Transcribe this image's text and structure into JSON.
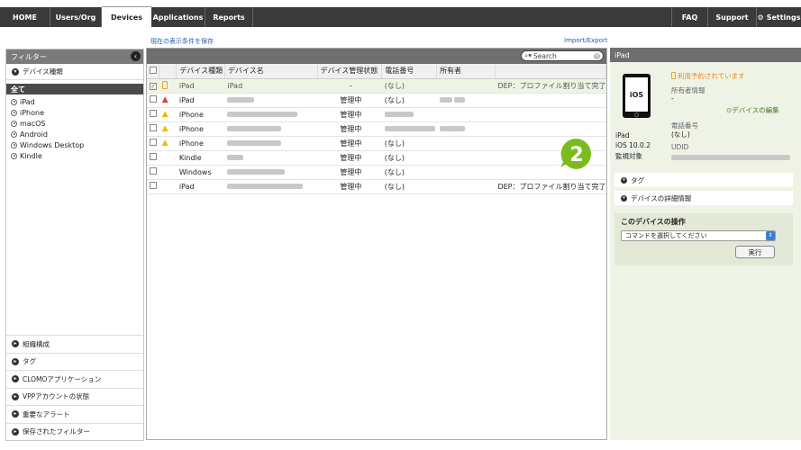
{
  "nav": {
    "tabs": [
      "HOME",
      "Users/Org",
      "Devices",
      "Applications",
      "Reports"
    ],
    "right": [
      "FAQ",
      "Support",
      "Settings"
    ],
    "active": "Devices"
  },
  "links": {
    "save_view": "現在の表示条件を保存",
    "import_export": "Import/Export"
  },
  "filter": {
    "title": "フィルター",
    "device_type_section": "デバイス種類",
    "items": [
      "全て",
      "iPad",
      "iPhone",
      "macOS",
      "Android",
      "Windows Desktop",
      "Kindle"
    ],
    "bottom_sections": [
      "組織構成",
      "タグ",
      "CLOMOアプリケーション",
      "VPPアカウントの状態",
      "重要なアラート",
      "保存されたフィルター"
    ]
  },
  "search": {
    "placeholder": "Search"
  },
  "table": {
    "headers": [
      "デバイス種類",
      "デバイス名",
      "デバイス管理状態",
      "電話番号",
      "所有者"
    ],
    "rows": [
      {
        "type": "iPad",
        "name": "iPad",
        "status": "–",
        "phone": "(なし)",
        "owner": "",
        "note": "DEP：プロファイル割り当て完了",
        "icon": "tablet"
      },
      {
        "type": "iPad",
        "name": "",
        "status": "管理中",
        "phone": "(なし)",
        "owner": "",
        "note": "",
        "icon": "alert-red"
      },
      {
        "type": "iPhone",
        "name": "",
        "status": "管理中",
        "phone": "",
        "owner": "",
        "note": "",
        "icon": "alert-yellow"
      },
      {
        "type": "iPhone",
        "name": "",
        "status": "管理中",
        "phone": "",
        "owner": "",
        "note": "",
        "icon": "alert-yellow"
      },
      {
        "type": "iPhone",
        "name": "",
        "status": "管理中",
        "phone": "(なし)",
        "owner": "",
        "note": "",
        "icon": "alert-yellow"
      },
      {
        "type": "Kindle",
        "name": "",
        "status": "管理中",
        "phone": "(なし)",
        "owner": "",
        "note": "",
        "icon": ""
      },
      {
        "type": "Windows",
        "name": "",
        "status": "管理中",
        "phone": "(なし)",
        "owner": "",
        "note": "",
        "icon": ""
      },
      {
        "type": "iPad",
        "name": "",
        "status": "管理中",
        "phone": "(なし)",
        "owner": "",
        "note": "DEP：プロファイル割り当て完了",
        "icon": ""
      }
    ]
  },
  "detail": {
    "title": "iPad",
    "reserved": "利用予約されています",
    "owner_label": "所有者情報",
    "owner_value": "-",
    "edit_link": "デバイスの編集",
    "phone_label": "電話番号",
    "phone_value": "(なし)",
    "udid_label": "UDID",
    "device_name": "iPad",
    "os": "iOS 10.0.2",
    "supervised": "監視対象",
    "screen_text": "iOS",
    "tag_section": "タグ",
    "details_section": "デバイスの詳細情報",
    "ops_title": "このデバイスの操作",
    "ops_select": "コマンドを選択してください",
    "ops_run": "実行"
  },
  "callout": {
    "number": "2",
    "color": "#7cbb1e"
  }
}
